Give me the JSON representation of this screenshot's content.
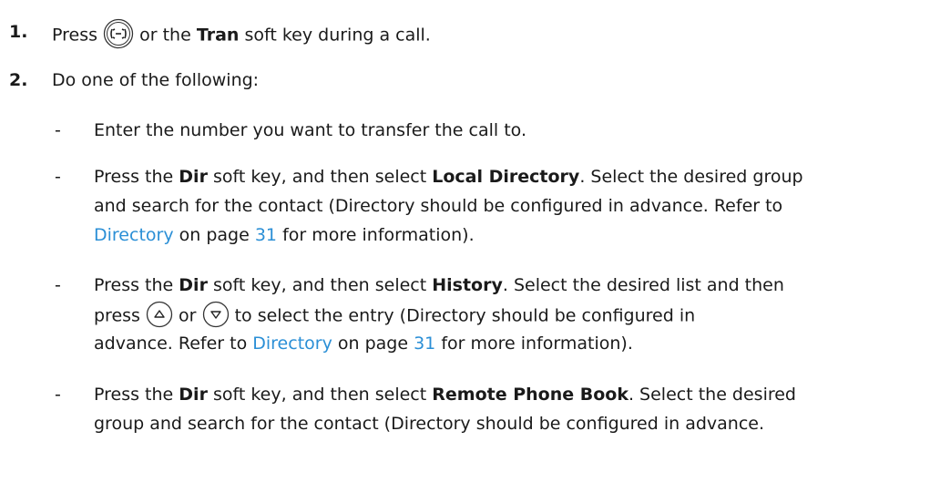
{
  "steps": [
    {
      "number": "1.",
      "prefix": "Press",
      "icon": "transfer-key-icon",
      "mid": "or the",
      "key": "Tran",
      "suffix": "soft key during a call."
    },
    {
      "number": "2.",
      "text": "Do one of the following:"
    }
  ],
  "bullets": [
    {
      "dash": "-",
      "lines": [
        "Enter the number you want to transfer the call to."
      ]
    },
    {
      "dash": "-",
      "l1_a": "Press the",
      "l1_key1": "Dir",
      "l1_b": "soft key, and then select",
      "l1_key2": "Local Directory",
      "l1_c": ". Select the desired group",
      "l2": "and search for the contact (Directory should be configured in advance. Refer to",
      "l3_link": "Directory",
      "l3_a": "on page",
      "l3_page": "31",
      "l3_b": "for more information)."
    },
    {
      "dash": "-",
      "l1_a": "Press the",
      "l1_key1": "Dir",
      "l1_b": "soft key, and then select",
      "l1_key2": "History",
      "l1_c": ". Select the desired list and then",
      "l2_a": "press",
      "up_icon": "up-arrow-key-icon",
      "l2_or": "or",
      "down_icon": "down-arrow-key-icon",
      "l2_b": "to select the entry (Directory should be configured in",
      "l3_a": "advance. Refer to",
      "l3_link": "Directory",
      "l3_b": "on page",
      "l3_page": "31",
      "l3_c": "for more information)."
    },
    {
      "dash": "-",
      "l1_a": "Press the",
      "l1_key1": "Dir",
      "l1_b": "soft key, and then select",
      "l1_key2": "Remote Phone Book",
      "l1_c": ". Select the desired",
      "l2": "group and search for the contact (Directory should be configured in advance."
    }
  ],
  "colors": {
    "text": "#1a1a1a",
    "link": "#2b8fd6"
  }
}
